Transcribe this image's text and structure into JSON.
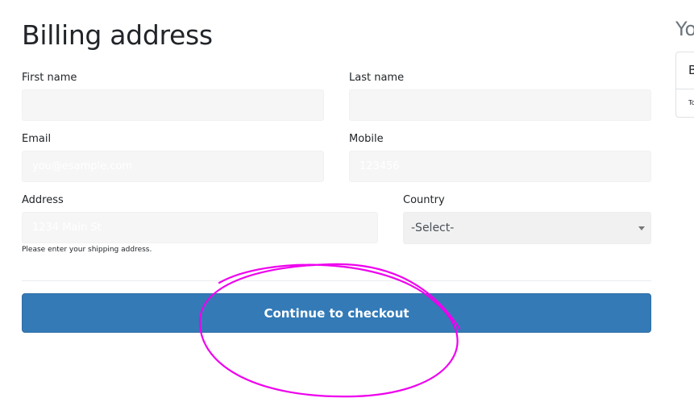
{
  "form": {
    "title": "Billing address",
    "first_name": {
      "label": "First name",
      "value": "",
      "placeholder": ""
    },
    "last_name": {
      "label": "Last name",
      "value": "",
      "placeholder": ""
    },
    "email": {
      "label": "Email",
      "value": "",
      "placeholder": "you@esample.com"
    },
    "mobile": {
      "label": "Mobile",
      "value": "",
      "placeholder": "123456"
    },
    "address": {
      "label": "Address",
      "value": "",
      "placeholder": "1234 Main St",
      "help": "Please enter your shipping address."
    },
    "country": {
      "label": "Country",
      "selected": "-Select-"
    },
    "submit_label": "Continue to checkout"
  },
  "sidebar": {
    "title": "Yo",
    "card_row1": "B",
    "card_row2": "To"
  },
  "colors": {
    "primary": "#337ab7",
    "input_bg": "#f6f6f6",
    "annotation": "#ee00ee"
  }
}
